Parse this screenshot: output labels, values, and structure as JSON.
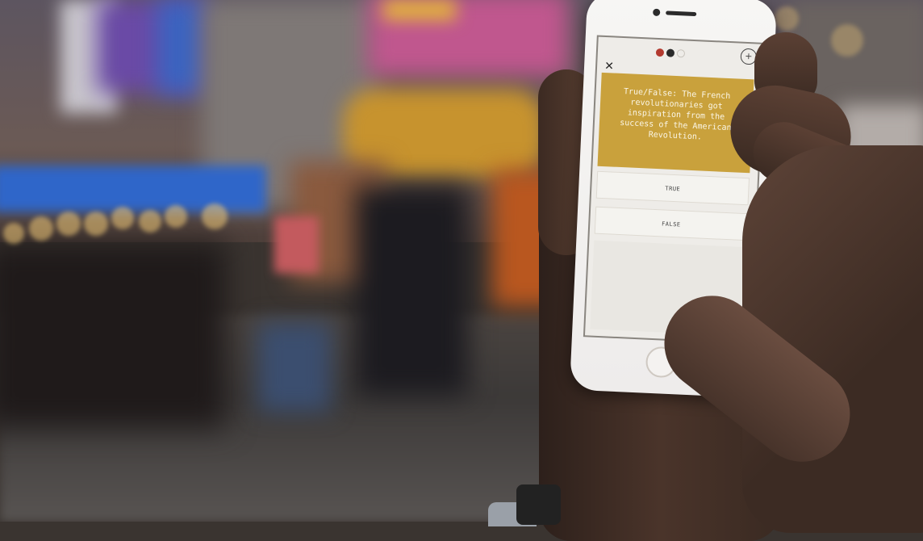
{
  "app": {
    "progress": {
      "dot1": "",
      "dot2": "",
      "dot3": ""
    },
    "badge": "+",
    "close": "✕",
    "question": "True/False: The French revolutionaries got inspiration from the success of the American Revolution.",
    "answers": [
      {
        "label": "TRUE"
      },
      {
        "label": "FALSE"
      }
    ]
  },
  "colors": {
    "question_bg": "#c9a13c",
    "accent_red": "#b33a2f"
  },
  "icons": {
    "close": "close-icon",
    "badge": "plus-circle-icon",
    "home": "home-button"
  }
}
